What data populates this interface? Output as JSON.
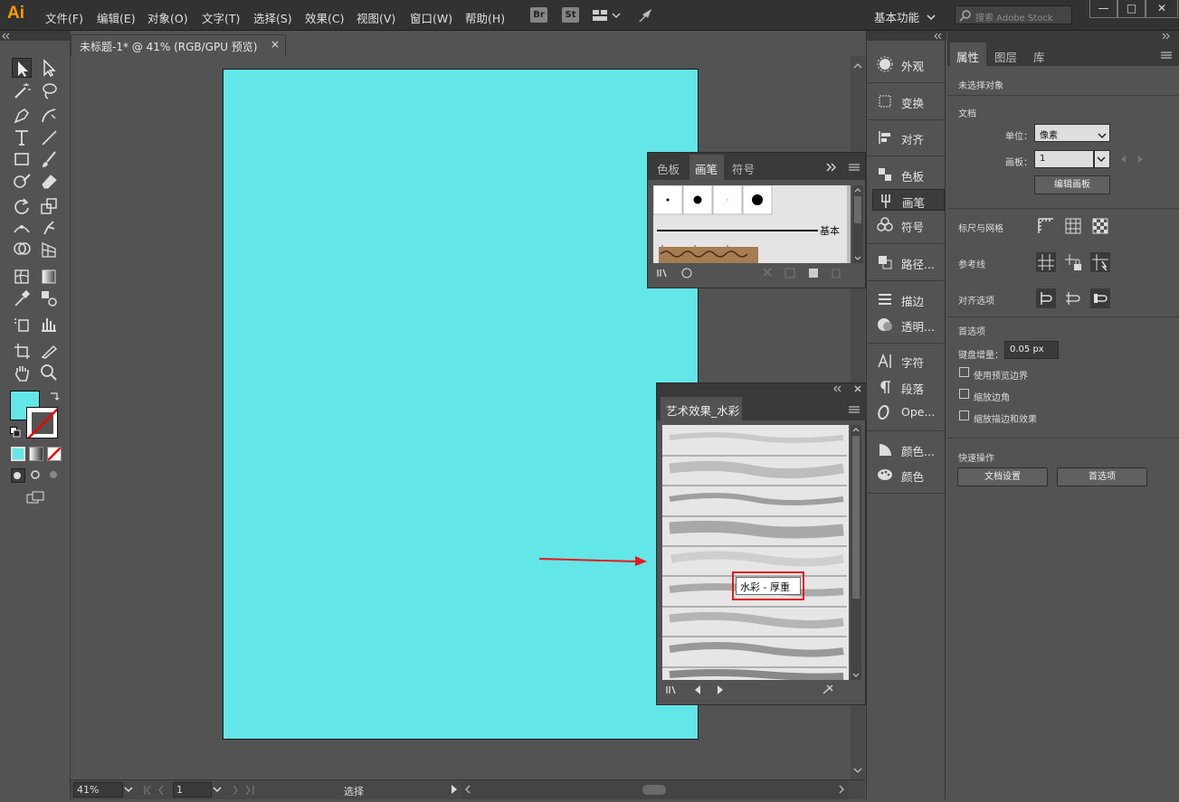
{
  "app": {
    "logo": "Ai",
    "menus": [
      "文件(F)",
      "编辑(E)",
      "对象(O)",
      "文字(T)",
      "选择(S)",
      "效果(C)",
      "视图(V)",
      "窗口(W)",
      "帮助(H)"
    ],
    "bridge_label": "Br",
    "stock_label": "St",
    "workspace": "基本功能",
    "search_placeholder": "搜索 Adobe Stock"
  },
  "document": {
    "tab_title": "未标题-1* @ 41% (RGB/GPU 预览)",
    "tab_close": "×",
    "artboard_color": "#63e6e8"
  },
  "status": {
    "zoom": "41%",
    "page": "1",
    "tool_label": "选择"
  },
  "dock": {
    "items": [
      "外观",
      "变换",
      "对齐",
      "色板",
      "画笔",
      "符号",
      "路径...",
      "描边",
      "透明...",
      "字符",
      "段落",
      "Ope...",
      "颜色...",
      "颜色"
    ]
  },
  "properties": {
    "tabs": [
      "属性",
      "图层",
      "库"
    ],
    "no_selection": "未选择对象",
    "doc_section": "文档",
    "unit_label": "单位：",
    "unit_value": "像素",
    "artboard_label": "画板：",
    "artboard_value": "1",
    "edit_artboard_btn": "编辑画板",
    "rulers_grids": "标尺与网格",
    "guides": "参考线",
    "snap_options": "对齐选项",
    "preferences": "首选项",
    "keyboard_increment_label": "键盘增量：",
    "keyboard_increment_value": "0.05 px",
    "chk_preview_bounds": "使用预览边界",
    "chk_scale_corners": "缩放边角",
    "chk_scale_strokes": "缩放描边和效果",
    "quick_actions": "快速操作",
    "doc_setup_btn": "文档设置",
    "prefs_btn": "首选项"
  },
  "brush_panel": {
    "tabs": [
      "色板",
      "画笔",
      "符号"
    ],
    "basic_label": "基本"
  },
  "watercolor_panel": {
    "title": "艺术效果_水彩",
    "tooltip": "水彩 - 厚重"
  },
  "colors": {
    "accent_red": "#e8191c",
    "fill_swatch": "#63e6e8"
  }
}
